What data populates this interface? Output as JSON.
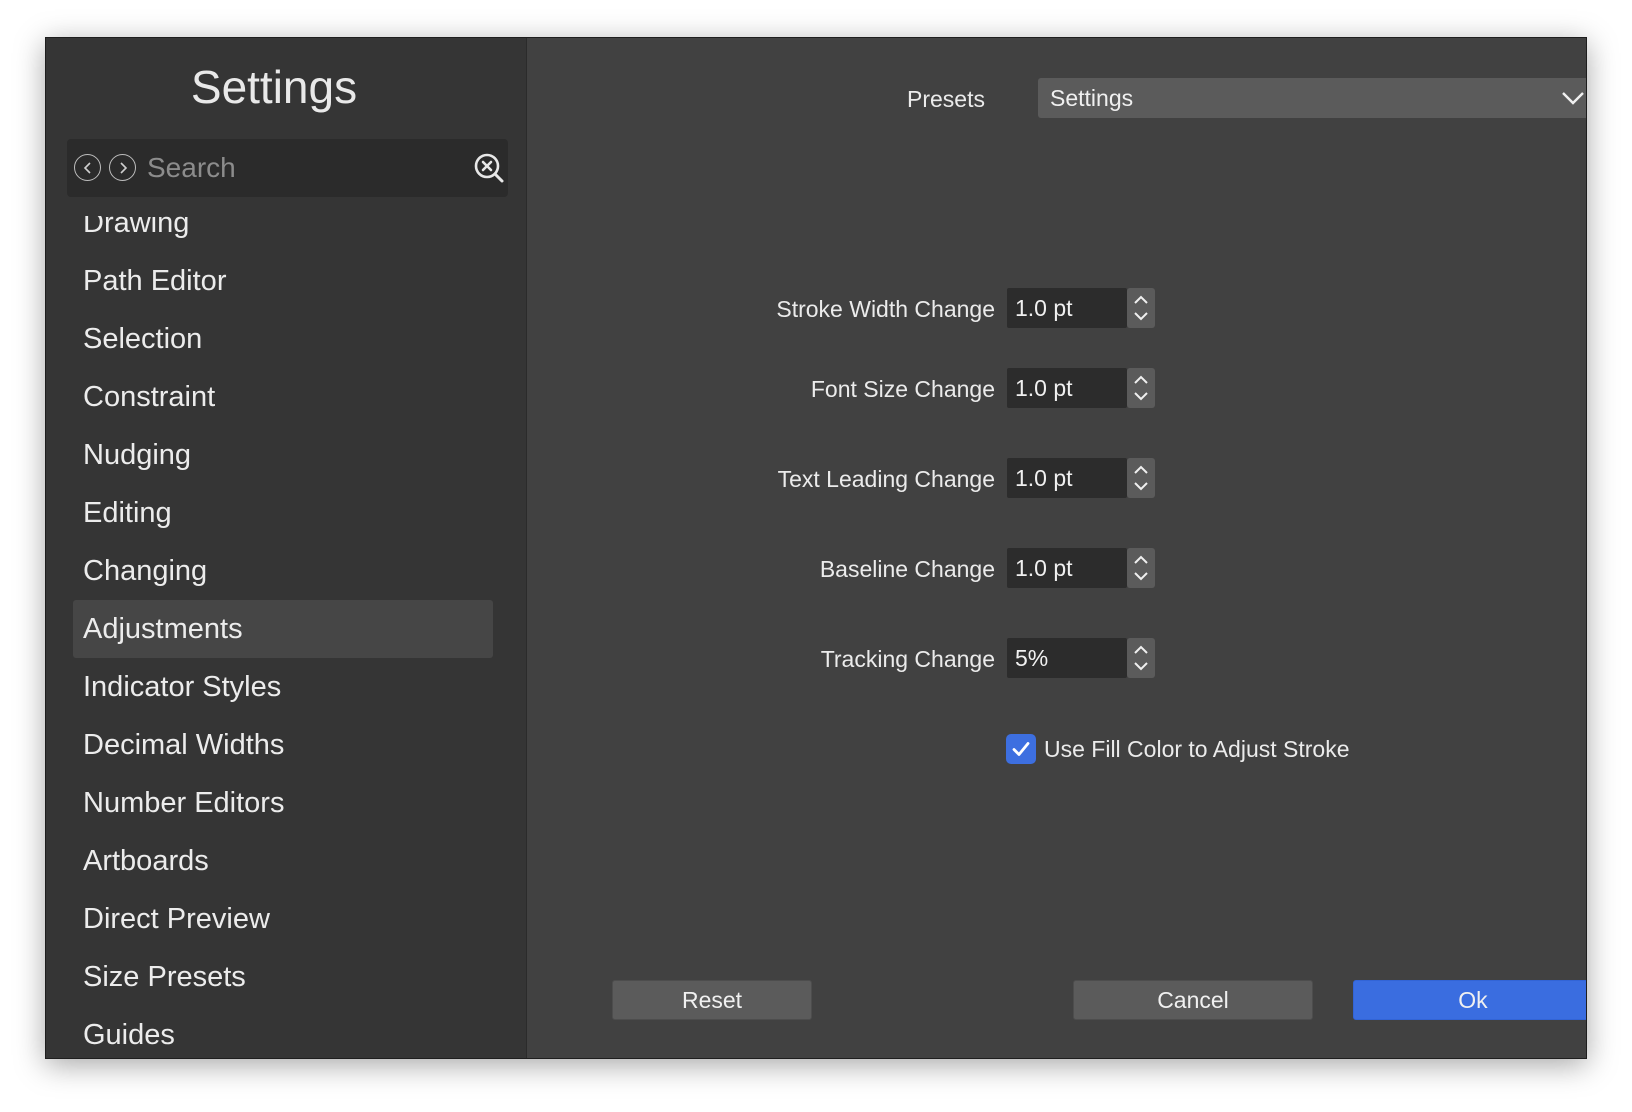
{
  "sidebar": {
    "title": "Settings",
    "search": {
      "placeholder": "Search",
      "value": ""
    },
    "items": [
      {
        "label": "Drawing"
      },
      {
        "label": "Path Editor"
      },
      {
        "label": "Selection"
      },
      {
        "label": "Constraint"
      },
      {
        "label": "Nudging"
      },
      {
        "label": "Editing"
      },
      {
        "label": "Changing"
      },
      {
        "label": "Adjustments",
        "selected": true
      },
      {
        "label": "Indicator Styles"
      },
      {
        "label": "Decimal Widths"
      },
      {
        "label": "Number Editors"
      },
      {
        "label": "Artboards"
      },
      {
        "label": "Direct Preview"
      },
      {
        "label": "Size Presets"
      },
      {
        "label": "Guides"
      }
    ]
  },
  "main": {
    "presets": {
      "label": "Presets",
      "value": "Settings"
    },
    "fields": [
      {
        "label": "Stroke Width Change",
        "value": "1.0 pt"
      },
      {
        "label": "Font Size Change",
        "value": "1.0 pt"
      },
      {
        "label": "Text Leading Change",
        "value": "1.0 pt"
      },
      {
        "label": "Baseline Change",
        "value": "1.0 pt"
      },
      {
        "label": "Tracking Change",
        "value": "5%"
      }
    ],
    "checkbox": {
      "label": "Use Fill Color to Adjust Stroke",
      "checked": true
    }
  },
  "buttons": {
    "reset": "Reset",
    "cancel": "Cancel",
    "ok": "Ok"
  },
  "colors": {
    "accent": "#3a6de0",
    "window_bg": "#414141",
    "sidebar_bg": "#353535"
  },
  "icons": {
    "back": "chevron-left-icon",
    "forward": "chevron-right-icon",
    "clear": "clear-search-icon",
    "dropdown": "chevron-down-icon",
    "stepper": "up-down-stepper-icon",
    "check": "checkmark-icon"
  }
}
